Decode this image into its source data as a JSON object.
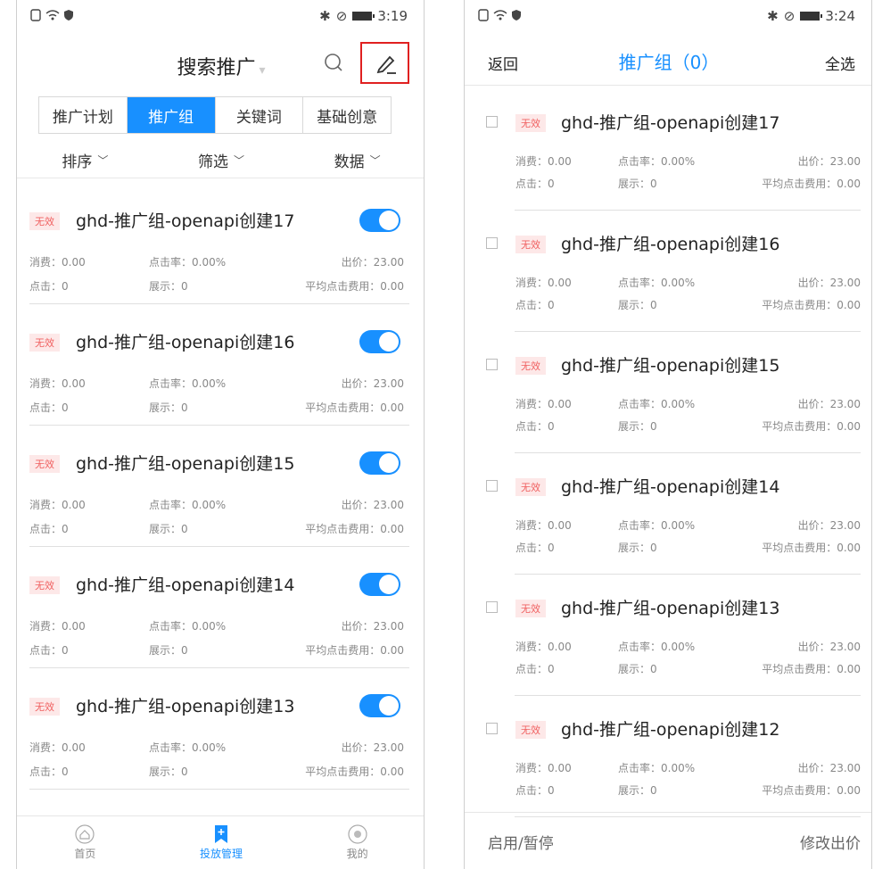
{
  "left": {
    "status": {
      "time": "3:19"
    },
    "header": {
      "title": "搜索推广"
    },
    "tabs": [
      "推广计划",
      "推广组",
      "关键词",
      "基础创意"
    ],
    "active_tab": 1,
    "filters": [
      "排序",
      "筛选",
      "数据"
    ],
    "items": [
      {
        "badge": "无效",
        "name": "ghd-推广组-openapi创建17",
        "spend": "消费：0.00",
        "ctr": "点击率：0.00%",
        "bid": "出价：23.00",
        "clicks": "点击：0",
        "impressions": "展示：0",
        "avg_cpc": "平均点击费用：0.00"
      },
      {
        "badge": "无效",
        "name": "ghd-推广组-openapi创建16",
        "spend": "消费：0.00",
        "ctr": "点击率：0.00%",
        "bid": "出价：23.00",
        "clicks": "点击：0",
        "impressions": "展示：0",
        "avg_cpc": "平均点击费用：0.00"
      },
      {
        "badge": "无效",
        "name": "ghd-推广组-openapi创建15",
        "spend": "消费：0.00",
        "ctr": "点击率：0.00%",
        "bid": "出价：23.00",
        "clicks": "点击：0",
        "impressions": "展示：0",
        "avg_cpc": "平均点击费用：0.00"
      },
      {
        "badge": "无效",
        "name": "ghd-推广组-openapi创建14",
        "spend": "消费：0.00",
        "ctr": "点击率：0.00%",
        "bid": "出价：23.00",
        "clicks": "点击：0",
        "impressions": "展示：0",
        "avg_cpc": "平均点击费用：0.00"
      },
      {
        "badge": "无效",
        "name": "ghd-推广组-openapi创建13",
        "spend": "消费：0.00",
        "ctr": "点击率：0.00%",
        "bid": "出价：23.00",
        "clicks": "点击：0",
        "impressions": "展示：0",
        "avg_cpc": "平均点击费用：0.00"
      }
    ],
    "tabbar": [
      "首页",
      "投放管理",
      "我的"
    ],
    "tabbar_active": 1
  },
  "right": {
    "status": {
      "time": "3:24"
    },
    "header": {
      "back": "返回",
      "title": "推广组（0）",
      "select_all": "全选"
    },
    "items": [
      {
        "badge": "无效",
        "name": "ghd-推广组-openapi创建17",
        "spend": "消费：0.00",
        "ctr": "点击率：0.00%",
        "bid": "出价：23.00",
        "clicks": "点击：0",
        "impressions": "展示：0",
        "avg_cpc": "平均点击费用：0.00"
      },
      {
        "badge": "无效",
        "name": "ghd-推广组-openapi创建16",
        "spend": "消费：0.00",
        "ctr": "点击率：0.00%",
        "bid": "出价：23.00",
        "clicks": "点击：0",
        "impressions": "展示：0",
        "avg_cpc": "平均点击费用：0.00"
      },
      {
        "badge": "无效",
        "name": "ghd-推广组-openapi创建15",
        "spend": "消费：0.00",
        "ctr": "点击率：0.00%",
        "bid": "出价：23.00",
        "clicks": "点击：0",
        "impressions": "展示：0",
        "avg_cpc": "平均点击费用：0.00"
      },
      {
        "badge": "无效",
        "name": "ghd-推广组-openapi创建14",
        "spend": "消费：0.00",
        "ctr": "点击率：0.00%",
        "bid": "出价：23.00",
        "clicks": "点击：0",
        "impressions": "展示：0",
        "avg_cpc": "平均点击费用：0.00"
      },
      {
        "badge": "无效",
        "name": "ghd-推广组-openapi创建13",
        "spend": "消费：0.00",
        "ctr": "点击率：0.00%",
        "bid": "出价：23.00",
        "clicks": "点击：0",
        "impressions": "展示：0",
        "avg_cpc": "平均点击费用：0.00"
      },
      {
        "badge": "无效",
        "name": "ghd-推广组-openapi创建12",
        "spend": "消费：0.00",
        "ctr": "点击率：0.00%",
        "bid": "出价：23.00",
        "clicks": "点击：0",
        "impressions": "展示：0",
        "avg_cpc": "平均点击费用：0.00"
      }
    ],
    "bottom": {
      "toggle_action": "启用/暂停",
      "edit_bid": "修改出价"
    }
  },
  "colors": {
    "accent": "#1890ff",
    "badge_text": "#f06060",
    "badge_bg": "#fde8e8",
    "highlight": "#e02020"
  }
}
